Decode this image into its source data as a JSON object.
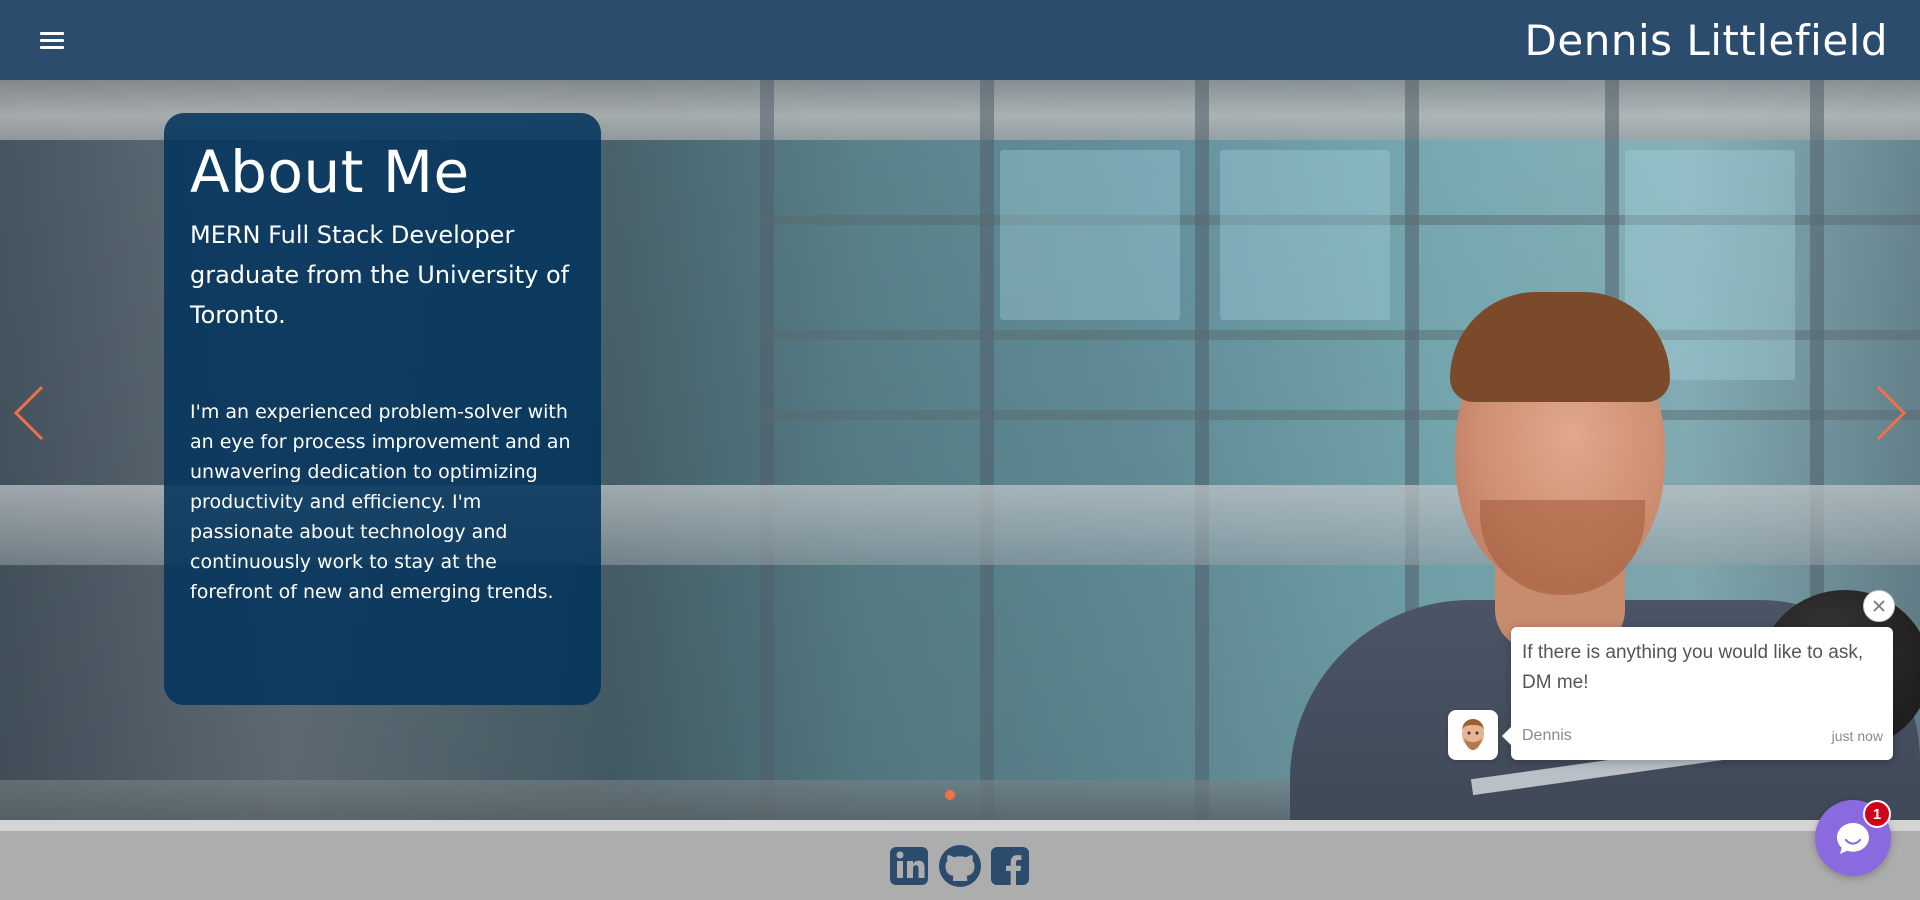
{
  "header": {
    "title": "Dennis Littlefield",
    "menu_icon": "hamburger-menu-icon"
  },
  "hero": {
    "about": {
      "title": "About Me",
      "subtitle": "MERN Full Stack Developer graduate from the University of Toronto.",
      "body": "I'm an experienced problem-solver with an eye for process improvement and an unwavering dedication to optimizing productivity and efficiency. I'm passionate about technology and continuously work to stay at the forefront of new and emerging trends."
    },
    "prev_icon": "chevron-left-icon",
    "next_icon": "chevron-right-icon",
    "slide_count": 1,
    "active_slide": 1
  },
  "footer": {
    "social": [
      {
        "name": "linkedin",
        "icon": "linkedin-icon"
      },
      {
        "name": "github",
        "icon": "github-icon"
      },
      {
        "name": "facebook",
        "icon": "facebook-icon"
      }
    ]
  },
  "chat": {
    "message": "If there is anything you would like to ask, DM me!",
    "author": "Dennis",
    "time": "just now",
    "unread_count": "1"
  },
  "colors": {
    "header_bg": "#2c4c6e",
    "card_bg": "#03345c",
    "accent_orange": "#f36f47",
    "footer_bg": "#adadad",
    "social_icon": "#2c4c6e",
    "chat_launcher": "#8b6ae0",
    "badge_red": "#d0021b"
  }
}
